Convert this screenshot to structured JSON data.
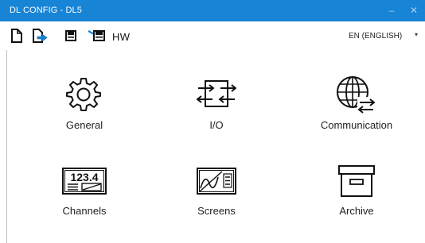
{
  "window": {
    "title": "DL CONFIG - DL5",
    "minimize": "–",
    "close": "✕"
  },
  "toolbar": {
    "hw_label": "HW",
    "language": {
      "selected": "EN (ENGLISH)",
      "arrow": "▾"
    }
  },
  "tiles": [
    {
      "label": "General",
      "icon": "gear-icon"
    },
    {
      "label": "I/O",
      "icon": "io-arrows-icon"
    },
    {
      "label": "Communication",
      "icon": "globe-exchange-icon"
    },
    {
      "label": "Channels",
      "icon": "channel-display-icon"
    },
    {
      "label": "Screens",
      "icon": "screen-chart-icon"
    },
    {
      "label": "Archive",
      "icon": "archive-box-icon"
    }
  ],
  "icon_texts": {
    "channels_value": "123.4"
  },
  "colors": {
    "titlebar": "#1784d6",
    "title_text": "#ffffff",
    "accent": "#1784d6"
  }
}
